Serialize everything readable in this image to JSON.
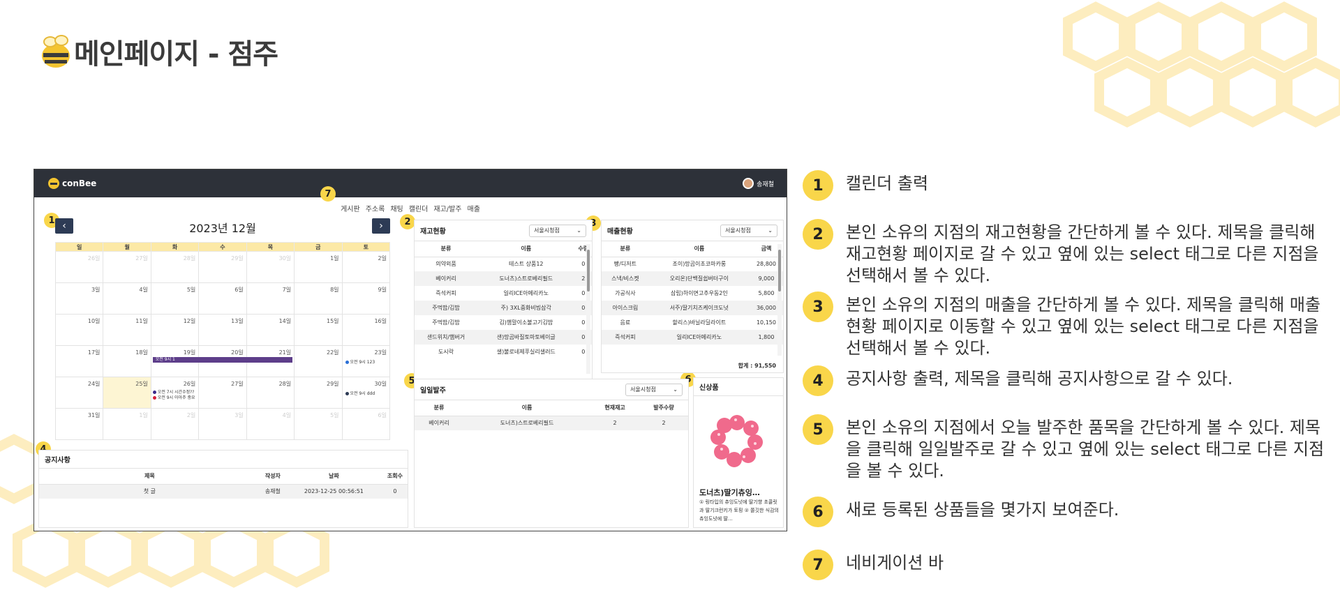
{
  "page": {
    "title": "메인페이지 - 점주"
  },
  "app": {
    "logo": "conBee",
    "user": "송재철",
    "nav": [
      "게시판",
      "주소록",
      "채팅",
      "캘린더",
      "재고/발주",
      "매출"
    ]
  },
  "calendar": {
    "title": "2023년 12월",
    "prev_icon": "‹",
    "next_icon": "›",
    "weekdays": [
      "일",
      "월",
      "화",
      "수",
      "목",
      "금",
      "토"
    ],
    "weeks": [
      [
        "26일",
        "27일",
        "28일",
        "29일",
        "30일",
        "1일",
        "2일"
      ],
      [
        "3일",
        "4일",
        "5일",
        "6일",
        "7일",
        "8일",
        "9일"
      ],
      [
        "10일",
        "11일",
        "12일",
        "13일",
        "14일",
        "15일",
        "16일"
      ],
      [
        "17일",
        "18일",
        "19일",
        "20일",
        "21일",
        "22일",
        "23일"
      ],
      [
        "24일",
        "25일",
        "26일",
        "27일",
        "28일",
        "29일",
        "30일"
      ],
      [
        "31일",
        "1일",
        "2일",
        "3일",
        "4일",
        "5일",
        "6일"
      ]
    ],
    "events": {
      "bar": "오전 9시 1",
      "sat23": "오전 9시 123",
      "tue26a": "오전 7시 시간수정??",
      "tue26b": "오전 9시 아아주 중요",
      "sat30": "오전 9시 ddd"
    }
  },
  "stock": {
    "title": "재고현황",
    "select": "서울시청점",
    "headers": [
      "분류",
      "이름",
      "수량"
    ],
    "rows": [
      [
        "의약외품",
        "테스트 상품12",
        "0"
      ],
      [
        "베이커리",
        "도너츠)스트로베리필드",
        "2"
      ],
      [
        "즉석커피",
        "일리ICE아메리카노",
        "0"
      ],
      [
        "주먹밥/김밥",
        "주) 3XL중화비빔삼각",
        "0"
      ],
      [
        "주먹밥/김밥",
        "김)햄말이소불고기김밥",
        "0"
      ],
      [
        "샌드위치/햄버거",
        "샌)망곰바질토마토베이글",
        "0"
      ],
      [
        "도시락",
        "샐)불로네제푸실리샐러드",
        "0"
      ]
    ]
  },
  "sales": {
    "title": "매출현황",
    "select": "서울시청점",
    "headers": [
      "분류",
      "이름",
      "금액"
    ],
    "rows": [
      [
        "빵/디저트",
        "조이)망곰이초코마카롱",
        "28,800"
      ],
      [
        "스낵/비스켓",
        "오리온)단백질쉽버터구이",
        "9,000"
      ],
      [
        "가공식사",
        "삼립)하이면고추우동2인",
        "5,800"
      ],
      [
        "아이스크림",
        "서주)딸기치즈케이크도넛",
        "36,000"
      ],
      [
        "음료",
        "할리스)바닐라딜라이트",
        "10,150"
      ],
      [
        "즉석커피",
        "일리ICE아메리카노",
        "1,800"
      ]
    ],
    "total": "합계 : 91,550"
  },
  "order": {
    "title": "일일발주",
    "select": "서울시청점",
    "headers": [
      "분류",
      "이름",
      "현재재고",
      "발주수량"
    ],
    "rows": [
      [
        "베이커리",
        "도너츠)스트로베리필드",
        "2",
        "2"
      ]
    ]
  },
  "new_product": {
    "title": "신상품",
    "name": "도너츠)딸기츄잉…",
    "desc": "① 링타입의 츄잉도넛에 딸기향 초콜릿과 딸기크런키가 토핑 ② 쫄깃한 식감의 츄잉도넛에 딸…"
  },
  "notice": {
    "title": "공지사항",
    "headers": [
      "제목",
      "작성자",
      "날짜",
      "조회수"
    ],
    "rows": [
      [
        "첫 글",
        "송재철",
        "2023-12-25 00:56:51",
        "0"
      ]
    ]
  },
  "badges": [
    "1",
    "2",
    "3",
    "4",
    "5",
    "6",
    "7"
  ],
  "legend": [
    {
      "num": "1",
      "text": "캘린더 출력"
    },
    {
      "num": "2",
      "text": "본인 소유의 지점의 재고현황을 간단하게 볼 수 있다. 제목을 클릭해 재고현황 페이지로 갈 수 있고 옆에 있는  select 태그로 다른 지점을 선택해서 볼 수 있다."
    },
    {
      "num": "3",
      "text": "본인 소유의 지점의 매출을 간단하게 볼 수 있다. 제목을 클릭해 매출현황 페이지로 이동할 수 있고 옆에 있는 select 태그로 다른 지점을 선택해서 볼 수 있다."
    },
    {
      "num": "4",
      "text": "공지사항 출력, 제목을 클릭해 공지사항으로 갈 수 있다."
    },
    {
      "num": "5",
      "text": "본인 소유의 지점에서 오늘 발주한 품목을 간단하게 볼 수 있다. 제목을 클릭해 일일발주로 갈 수 있고 옆에 있는 select 태그로 다른 지점을 볼 수 있다."
    },
    {
      "num": "6",
      "text": "새로 등록된 상품들을 몇가지 보여준다."
    },
    {
      "num": "7",
      "text": "네비게이션 바"
    }
  ],
  "colors": {
    "accent_yellow": "#f9d64a",
    "topbar": "#2d3139",
    "event_purple": "#5d3e8a"
  }
}
